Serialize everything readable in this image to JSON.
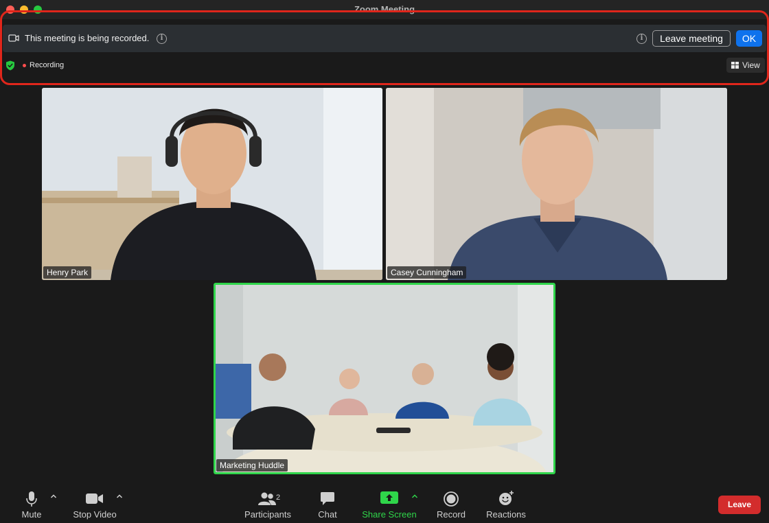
{
  "window": {
    "title": "Zoom Meeting"
  },
  "banner": {
    "message": "This meeting is being recorded.",
    "leave_label": "Leave meeting",
    "ok_label": "OK"
  },
  "status": {
    "recording_label": "Recording",
    "view_label": "View"
  },
  "participants": [
    {
      "name": "Henry Park"
    },
    {
      "name": "Casey Cunningham"
    },
    {
      "name": "Marketing Huddle"
    }
  ],
  "toolbar": {
    "mute": "Mute",
    "stop_video": "Stop Video",
    "participants": "Participants",
    "participants_count": "2",
    "chat": "Chat",
    "share_screen": "Share Screen",
    "record": "Record",
    "reactions": "Reactions",
    "leave": "Leave"
  },
  "colors": {
    "accent_blue": "#0e72ed",
    "share_green": "#2fd54a",
    "leave_red": "#d32c2c",
    "recording_red": "#ff4d4d",
    "highlight_red": "#e0261b"
  }
}
